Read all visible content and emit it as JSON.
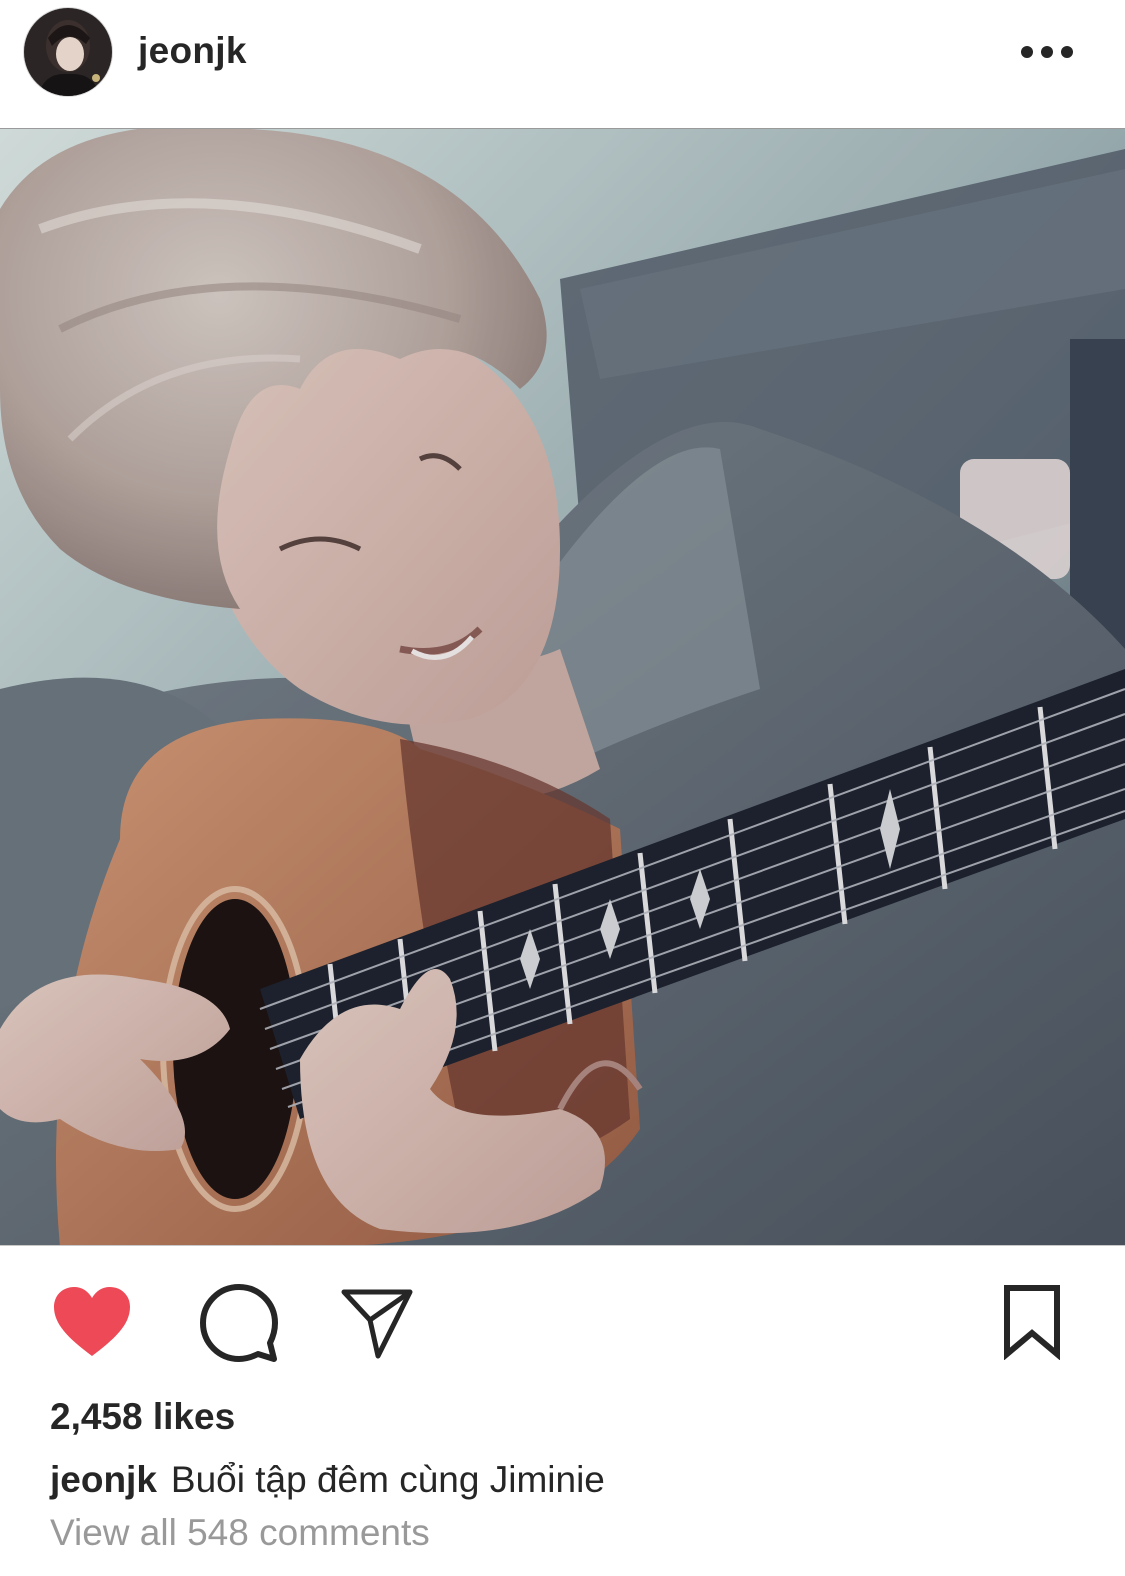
{
  "post": {
    "username": "jeonjk",
    "likes_text": "2,458 likes",
    "caption": {
      "username": "jeonjk",
      "text": "Buổi tập đêm cùng Jiminie"
    },
    "view_comments_text": "View all 548 comments"
  },
  "icons": {
    "more": "more-horizontal-icon",
    "like": "heart-filled-icon",
    "comment": "comment-bubble-icon",
    "share": "paper-plane-icon",
    "save": "bookmark-icon"
  },
  "colors": {
    "like_active": "#ed4956",
    "text_primary": "#262626",
    "text_secondary": "#999999",
    "background": "#ffffff"
  }
}
